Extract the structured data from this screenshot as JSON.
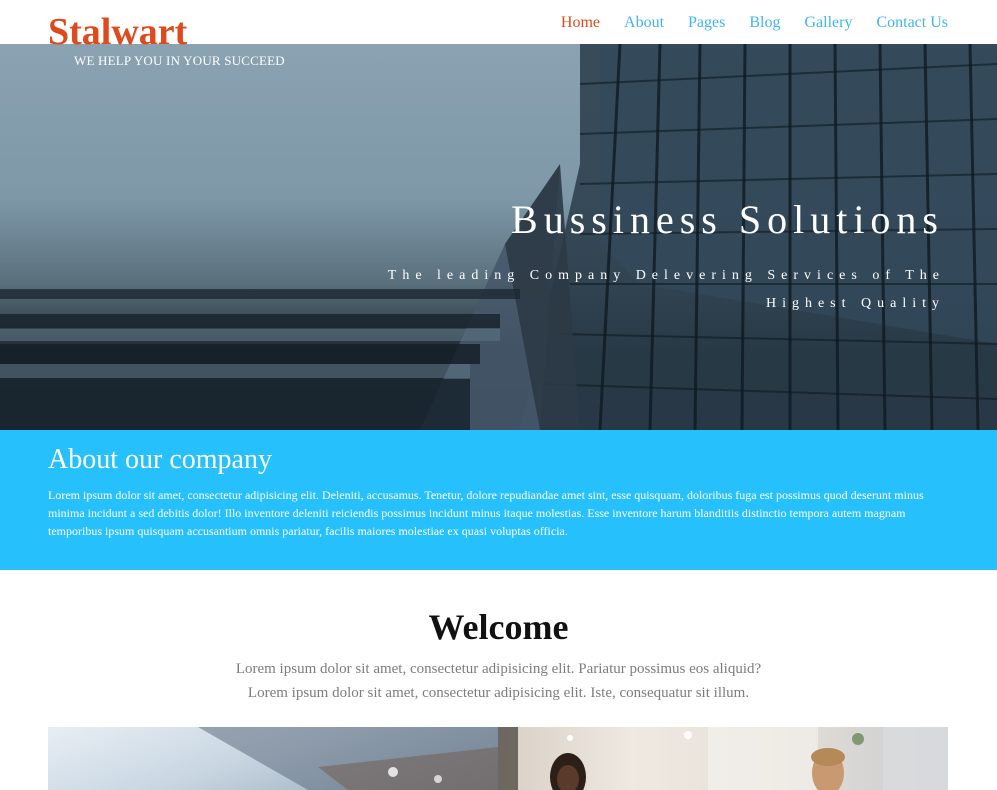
{
  "brand": {
    "name": "Stalwart",
    "tagline": "WE HELP YOU IN YOUR SUCCEED"
  },
  "nav": {
    "items": [
      {
        "label": "Home",
        "active": true
      },
      {
        "label": "About",
        "active": false
      },
      {
        "label": "Pages",
        "active": false
      },
      {
        "label": "Blog",
        "active": false
      },
      {
        "label": "Gallery",
        "active": false
      },
      {
        "label": "Contact Us",
        "active": false
      }
    ]
  },
  "hero": {
    "title": "Bussiness Solutions",
    "subtitle": "The leading Company Delevering Services of The Highest Quality"
  },
  "about": {
    "heading": "About our company",
    "body": "Lorem ipsum dolor sit amet, consectetur adipisicing elit. Deleniti, accusamus. Tenetur, dolore repudiandae amet sint, esse quisquam, doloribus fuga est possimus quod deserunt minus minima incidunt a sed debitis dolor! Illo inventore deleniti reiciendis possimus incidunt minus itaque molestias. Esse inventore harum blanditiis distinctio tempora autem magnam temporibus ipsum quisquam accusantium omnis pariatur, facilis maiores molestiae ex quasi voluptas officia."
  },
  "welcome": {
    "title": "Welcome",
    "line1": "Lorem ipsum dolor sit amet, consectetur adipisicing elit. Pariatur possimus eos aliquid?",
    "line2": "Lorem ipsum dolor sit amet, consectetur adipisicing elit. Iste, consequatur sit illum."
  },
  "colors": {
    "brand": "#de4a1c",
    "nav_link": "#3fb6ee",
    "about_bg": "#26c0fc"
  }
}
